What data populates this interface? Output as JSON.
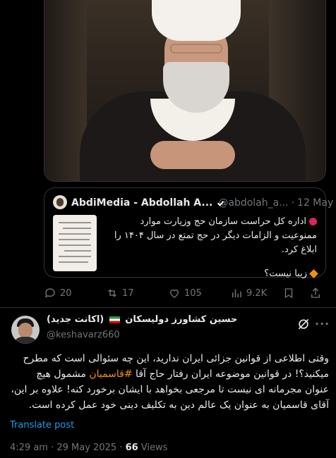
{
  "quoted_tweet": {
    "author_name": "AbdiMedia - Abdollah A...",
    "author_handle": "@abdolah_a...",
    "date": "12 May",
    "text_line1": "اداره کل حراست سازمان حج وزیارت موارد ممنوعیت و الزامات دیگر در حج تمتع در سال ۱۴۰۴ را ابلاغ کرد.",
    "text_line2": "زیبا نیست؟"
  },
  "actions": {
    "replies": "20",
    "reposts": "17",
    "likes": "105",
    "views": "9.2K"
  },
  "tweet": {
    "display_name": "حسین کشاورز دولیسکان",
    "display_name_suffix": "(اکانت جدید)",
    "handle": "@keshavarz660",
    "text_part1": "وقتی اطلاعی از قوانین جزائی ایران ندارید، این چه سئوالی است که مطرح میکنید؟! در قوانین موضوعه ایران رفتار حاج آقا ",
    "hashtag": "#قاسمیان",
    "text_part2": " مشمول هیچ عنوان مجرمانه ای نیست تا مرجعی بخواهد با ایشان برخورد کنه! علاوه بر این، آقای قاسمیان به عنوان یک عالم دین به تکلیف دینی خود عمل کرده است.",
    "translate_label": "Translate post",
    "time": "4:29 am",
    "date": "29 May 2025",
    "views_count": "66",
    "views_label": "Views"
  },
  "colors": {
    "accent": "#1d9bf0",
    "hashtag": "#f4900c",
    "muted": "#71767b",
    "border": "#2f3336"
  },
  "icons": [
    "reply-icon",
    "repost-icon",
    "like-icon",
    "views-icon",
    "grok-icon",
    "more-icon",
    "verified-badge-icon"
  ]
}
